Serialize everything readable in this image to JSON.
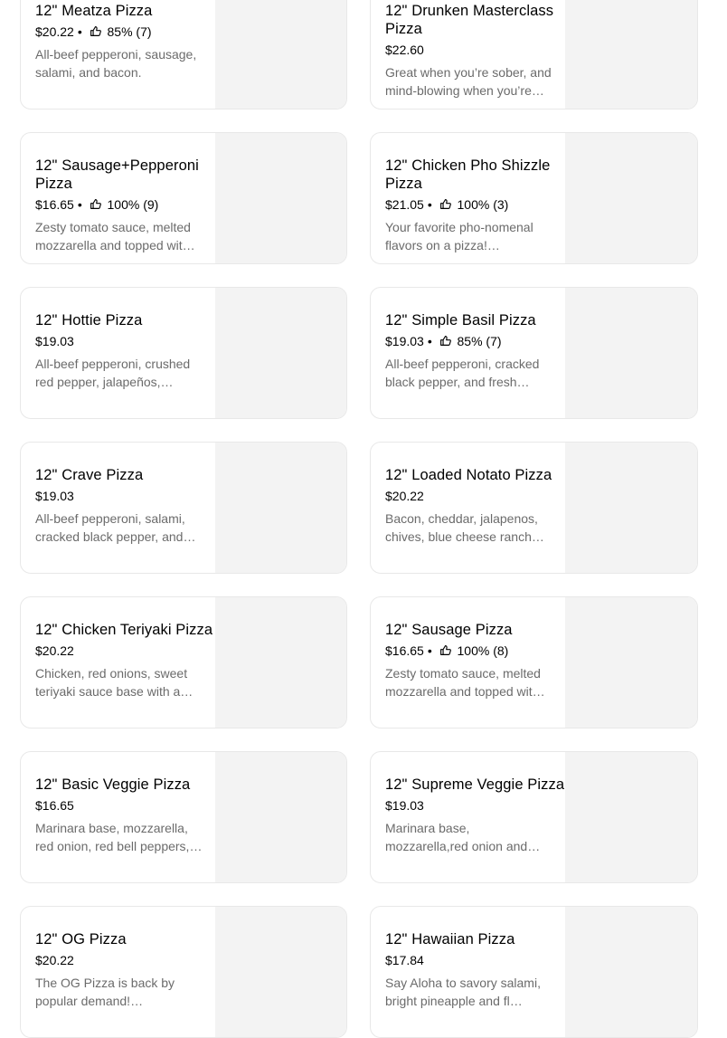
{
  "menu_items": [
    {
      "title": "12\" Meatza Pizza",
      "price": "$20.22",
      "rating": "85% (7)",
      "description": "All-beef pepperoni, sausage, salami, and bacon."
    },
    {
      "title": "12\" Drunken Masterclass Pizza",
      "price": "$22.60",
      "rating": "",
      "description": "Great when you’re sober, and mind-blowing when you’re…"
    },
    {
      "title": "12\" Sausage+Pepperoni Pizza",
      "price": "$16.65",
      "rating": "100% (9)",
      "description": "Zesty tomato sauce, melted mozzarella and topped wit…"
    },
    {
      "title": "12\" Chicken Pho Shizzle Pizza",
      "price": "$21.05",
      "rating": "100% (3)",
      "description": "Your favorite pho-nomenal flavors on a pizza! Chicken,…"
    },
    {
      "title": "12\" Hottie Pizza",
      "price": "$19.03",
      "rating": "",
      "description": "All-beef pepperoni, crushed red pepper, jalapeños,…"
    },
    {
      "title": "12\" Simple Basil Pizza",
      "price": "$19.03",
      "rating": "85% (7)",
      "description": "All-beef pepperoni, cracked black pepper, and fresh…"
    },
    {
      "title": "12\" Crave Pizza",
      "price": "$19.03",
      "rating": "",
      "description": "All-beef pepperoni, salami, cracked black pepper, and…"
    },
    {
      "title": "12\" Loaded Notato Pizza",
      "price": "$20.22",
      "rating": "",
      "description": "Bacon, cheddar, jalapenos, chives, blue cheese ranch…"
    },
    {
      "title": "12\" Chicken Teriyaki Pizza",
      "price": "$20.22",
      "rating": "",
      "description": "Chicken, red onions, sweet teriyaki sauce base with a…"
    },
    {
      "title": "12\" Sausage Pizza",
      "price": "$16.65",
      "rating": "100% (8)",
      "description": "Zesty tomato sauce, melted mozzarella and topped wit…"
    },
    {
      "title": "12\" Basic Veggie Pizza",
      "price": "$16.65",
      "rating": "",
      "description": "Marinara base, mozzarella, red onion, red bell peppers,…"
    },
    {
      "title": "12\" Supreme Veggie Pizza",
      "price": "$19.03",
      "rating": "",
      "description": "Marinara base, mozzarella,red onion and…"
    },
    {
      "title": "12\" OG Pizza",
      "price": "$20.22",
      "rating": "",
      "description": "The OG Pizza is back by popular demand!…"
    },
    {
      "title": "12\" Hawaiian Pizza",
      "price": "$17.84",
      "rating": "",
      "description": "Say Aloha to savory salami, bright pineapple and fl…"
    }
  ],
  "separator": "•",
  "icons": {
    "rating": "thumbs-up-icon"
  },
  "colors": {
    "card_border": "#e8e8e8",
    "image_placeholder": "#f3f3f3",
    "description": "#6b6b6b"
  }
}
